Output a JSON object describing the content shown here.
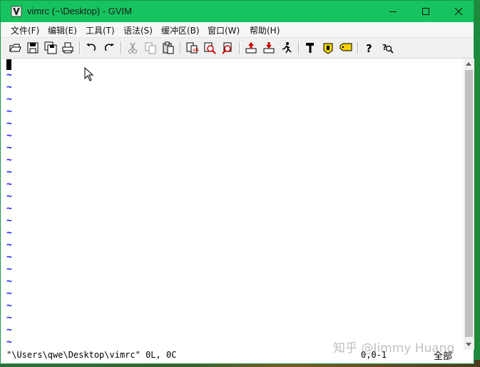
{
  "window": {
    "title": "vimrc (~\\Desktop) - GVIM",
    "accent_color": "#17c35f",
    "controls": [
      "minimize-icon",
      "maximize-icon",
      "close-icon"
    ]
  },
  "menu": {
    "items": [
      {
        "label": "文件(F)"
      },
      {
        "label": "编辑(E)"
      },
      {
        "label": "工具(T)"
      },
      {
        "label": "语法(S)"
      },
      {
        "label": "缓冲区(B)"
      },
      {
        "label": "窗口(W)"
      },
      {
        "label": "帮助(H)"
      }
    ]
  },
  "toolbar": {
    "buttons": [
      "open-icon",
      "save-icon",
      "save-all-icon",
      "print-icon",
      "undo-icon",
      "redo-icon",
      "cut-icon",
      "copy-icon",
      "paste-icon",
      "replace-icon",
      "find-next-icon",
      "find-prev-icon",
      "load-session-icon",
      "save-session-icon",
      "run-script-icon",
      "make-icon",
      "shell-icon",
      "tag-icon",
      "help-icon",
      "find-help-icon"
    ]
  },
  "editor": {
    "empty_line_marker": "~",
    "tilde_color": "#1010ff"
  },
  "statusline": {
    "message": "\"\\Users\\qwe\\Desktop\\vimrc\" 0L, 0C",
    "position": "0,0-1",
    "scroll": "全部"
  },
  "watermark": {
    "text": "知乎 @Jimmy Huang"
  }
}
